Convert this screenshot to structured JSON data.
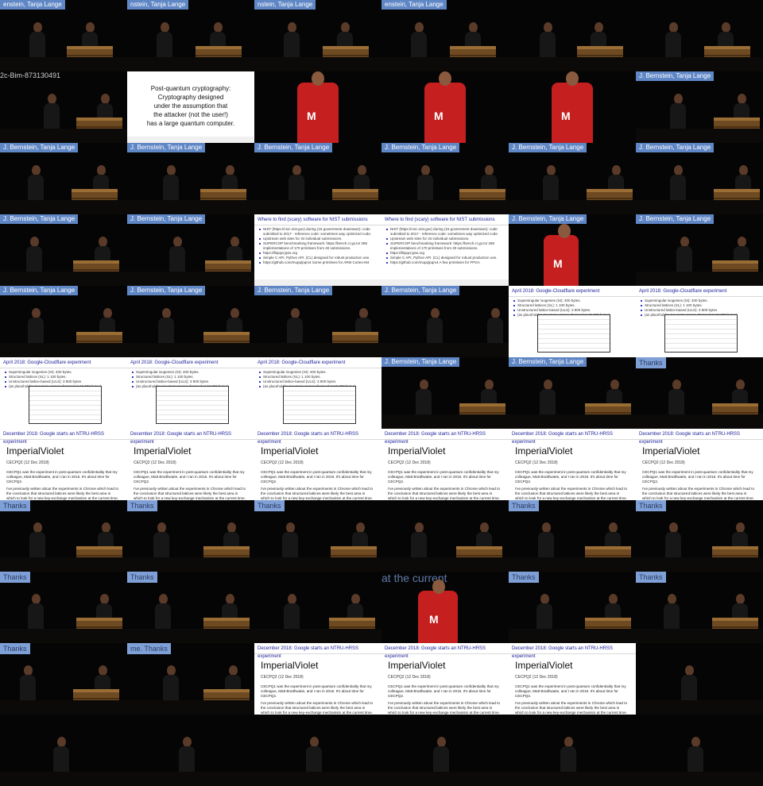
{
  "texts": {
    "r0c0": "enstein, Tanja Lange",
    "r0c1": "nstein, Tanja Lange",
    "r0c2": "nstein, Tanja Lange",
    "r0c3": "enstein, Tanja Lange",
    "r1c0": "2c-Bim-873130491",
    "r1c5": "J. Bernstein, Tanja Lange",
    "r2c0": "J. Bernstein, Tanja Lange",
    "r2c1": "J. Bernstein, Tanja Lange",
    "r2c2": "J. Bernstein, Tanja Lange",
    "r2c3": "J. Bernstein, Tanja Lange",
    "r2c4": "J. Bernstein, Tanja Lange",
    "r2c5": "J. Bernstein, Tanja Lange",
    "r3c0": "J. Bernstein, Tanja Lange",
    "r3c1": "J. Bernstein, Tanja Lange",
    "r3c2": "Where to find (scary) software for NIST submissions",
    "r3c3": "Where to find (scary) software for NIST submissions",
    "r3c4": "J. Bernstein, Tanja Lange",
    "r3c5": "J. Bernstein, Tanja Lange",
    "r4c0": "J. Bernstein, Tanja Lange",
    "r4c1": "J. Bernstein, Tanja Lange",
    "r4c2": "J. Bernstein, Tanja Lange",
    "r4c3": "J. Bernstein, Tanja Lange",
    "r4c4": "April 2018: Google-Cloudflare experiment",
    "r4c5": "April 2018: Google-Cloudflare experiment",
    "r5c0": "April 2018: Google-Cloudflare experiment",
    "r5c1": "April 2018: Google-Cloudflare experiment",
    "r5c2": "April 2018: Google-Cloudflare experiment",
    "r5c3": "J. Bernstein, Tanja Lange",
    "r5c4": "J. Bernstein, Tanja Lange",
    "r5c5": "Thanks",
    "r6": "December 2018: Google starts an NTRU-HRSS experiment",
    "r7": "Thanks",
    "r8c0": "Thanks",
    "r8c1": "Thanks",
    "r8c3": "at the current",
    "r8c4": "Thanks",
    "r8c5": "Thanks",
    "r9c0": "Thanks",
    "r9c1": "me. Thanks",
    "r9c2": "December 2018: Google starts an NTRU-HRSS experiment",
    "r9c3": "December 2018: Google starts an NTRU-HRSS experiment",
    "r9c4": "December 2018: Google starts an NTRU-HRSS experiment"
  },
  "slides": {
    "post": "Post-quantum cryptography:\nCryptography designed\nunder the assumption that\nthe attacker (not the user!)\nhas a large quantum computer.",
    "nist_bullets": [
      "NIST (https://csrc.nist.gov) during (15 government downtown): code submitted to 2017 - reference code: sometimes way optimized code.",
      "Upstream web sites for 34 individual submissions.",
      "SUPERCOP benchmarking framework: https://bench.cr.yp.to/ 286 implementations of 170 primitives from 40 submissions.",
      "https://libpqcrypto.org",
      "Simple C API, Python API. (CL) designed for robust production use.",
      "https://github.com/mupq/pqm4 Some primitives for ARM Cortex-M4",
      "https://github.com/mupq/pqm4 A few primitives for FPGA",
      "https://openquantumsafe.org"
    ],
    "cloudflare_bullets": [
      "Supersingular isogenies (SI): 400 bytes.",
      "Structured lattices (SL): 1 100 bytes.",
      "Unstructured lattice-based (ULS): 3 800 bytes",
      "(as placeholder, too many pages dropped at 10 000 bytes)"
    ],
    "imperial": {
      "brand": "ImperialViolet",
      "date": "CECPQ2 (12 Dec 2018)",
      "p1": "CECPQ1 was the experiment in post-quantum confidentiality that my colleague, Matt Braithwaite, and I ran in 2016. It's about time for CECPQ2.",
      "p2": "I've previously written about the experiments in Chrome which lead to the conclusion that structured lattices were likely the best area in which to look for a new key-exchange mechanism at the current time. Thanks"
    }
  }
}
